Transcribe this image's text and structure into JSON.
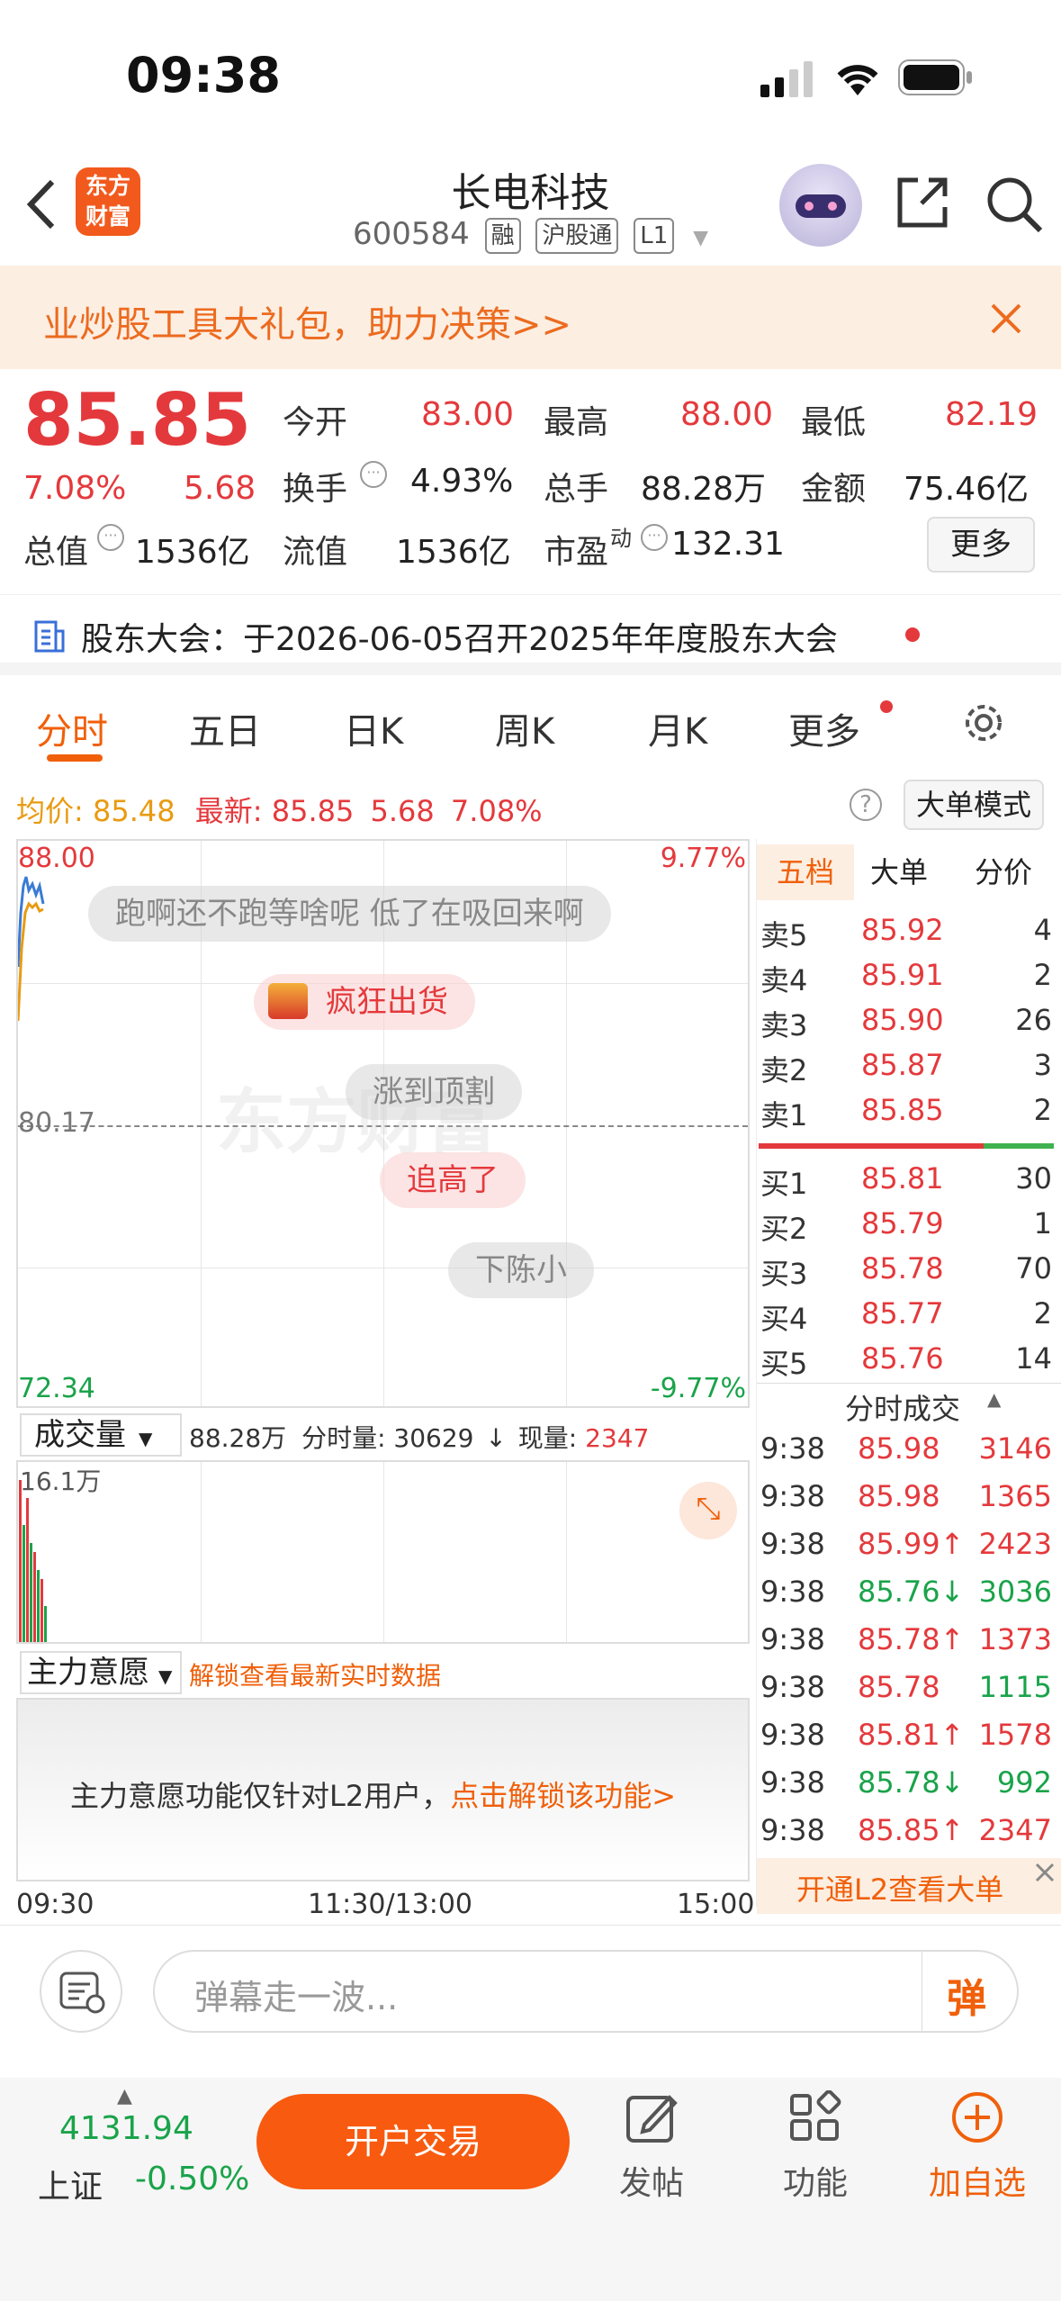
{
  "status_bar": {
    "time": "09:38"
  },
  "header": {
    "app_logo": "东方财富",
    "title": "长电科技",
    "code": "600584",
    "tags": [
      "融",
      "沪股通",
      "L1"
    ]
  },
  "banner": {
    "text": "业炒股工具大礼包，助力决策>>"
  },
  "quote": {
    "price": "85.85",
    "change_pct": "7.08%",
    "change": "5.68",
    "open_label": "今开",
    "open": "83.00",
    "high_label": "最高",
    "high": "88.00",
    "low_label": "最低",
    "low": "82.19",
    "turnover_label": "换手",
    "turnover": "4.93%",
    "volume_label": "总手",
    "volume": "88.28万",
    "amount_label": "金额",
    "amount": "75.46亿",
    "mktcap_label": "总值",
    "mktcap": "1536亿",
    "float_label": "流值",
    "float": "1536亿",
    "pe_label": "市盈",
    "pe_sup": "动",
    "pe": "132.31",
    "more": "更多"
  },
  "notice": {
    "text": "股东大会：于2026-06-05召开2025年年度股东大会"
  },
  "tabs": [
    "分时",
    "五日",
    "日K",
    "周K",
    "月K",
    "更多"
  ],
  "chart_header": {
    "avg_label": "均价:",
    "avg": "85.48",
    "latest_label": "最新:",
    "latest": "85.85",
    "chg": "5.68",
    "pct": "7.08%",
    "mode_btn": "大单模式"
  },
  "chart": {
    "top_price": "88.00",
    "top_pct": "9.77%",
    "mid_price": "80.17",
    "bottom_price": "72.34",
    "bottom_pct": "-9.77%",
    "watermark": "东方财富",
    "bubbles": [
      "跑啊还不跑等啥呢 低了在吸回来啊",
      "疯狂出货",
      "涨到顶割",
      "追高了",
      "下陈小"
    ]
  },
  "orderbook": {
    "tabs": [
      "五档",
      "大单",
      "分价"
    ],
    "asks": [
      {
        "label": "卖5",
        "price": "85.92",
        "vol": "4"
      },
      {
        "label": "卖4",
        "price": "85.91",
        "vol": "2"
      },
      {
        "label": "卖3",
        "price": "85.90",
        "vol": "26"
      },
      {
        "label": "卖2",
        "price": "85.87",
        "vol": "3"
      },
      {
        "label": "卖1",
        "price": "85.85",
        "vol": "2"
      }
    ],
    "bids": [
      {
        "label": "买1",
        "price": "85.81",
        "vol": "30"
      },
      {
        "label": "买2",
        "price": "85.79",
        "vol": "1"
      },
      {
        "label": "买3",
        "price": "85.78",
        "vol": "70"
      },
      {
        "label": "买4",
        "price": "85.77",
        "vol": "2"
      },
      {
        "label": "买5",
        "price": "85.76",
        "vol": "14"
      }
    ],
    "trades_title": "分时成交",
    "trades": [
      {
        "t": "9:38",
        "p": "85.98",
        "v": "3146",
        "c": "red"
      },
      {
        "t": "9:38",
        "p": "85.98",
        "v": "1365",
        "c": "red"
      },
      {
        "t": "9:38",
        "p": "85.99↑",
        "v": "2423",
        "c": "red"
      },
      {
        "t": "9:38",
        "p": "85.76↓",
        "v": "3036",
        "c": "green"
      },
      {
        "t": "9:38",
        "p": "85.78↑",
        "v": "1373",
        "c": "red"
      },
      {
        "t": "9:38",
        "p": "85.78",
        "v": "1115",
        "c": "green"
      },
      {
        "t": "9:38",
        "p": "85.81↑",
        "v": "1578",
        "c": "red"
      },
      {
        "t": "9:38",
        "p": "85.78↓",
        "v": "992",
        "c": "green"
      },
      {
        "t": "9:38",
        "p": "85.85↑",
        "v": "2347",
        "c": "red"
      }
    ],
    "l2_btn": "开通L2查看大单"
  },
  "volume": {
    "selector": "成交量",
    "total": "88.28万",
    "period_label": "分时量:",
    "period": "30629",
    "now_label": "现量:",
    "now": "2347",
    "max": "16.1万"
  },
  "mainforce": {
    "selector": "主力意愿",
    "unlock": "解锁查看最新实时数据",
    "msg": "主力意愿功能仅针对L2用户，",
    "link": "点击解锁该功能>"
  },
  "time_axis": [
    "09:30",
    "11:30/13:00",
    "15:00"
  ],
  "danmu": {
    "placeholder": "弹幕走一波...",
    "btn": "弹"
  },
  "index": {
    "value": "4131.94",
    "name": "上证",
    "chg": "-0.50%"
  },
  "bottom": {
    "open_btn": "开户交易",
    "post": "发帖",
    "func": "功能",
    "add": "加自选"
  }
}
